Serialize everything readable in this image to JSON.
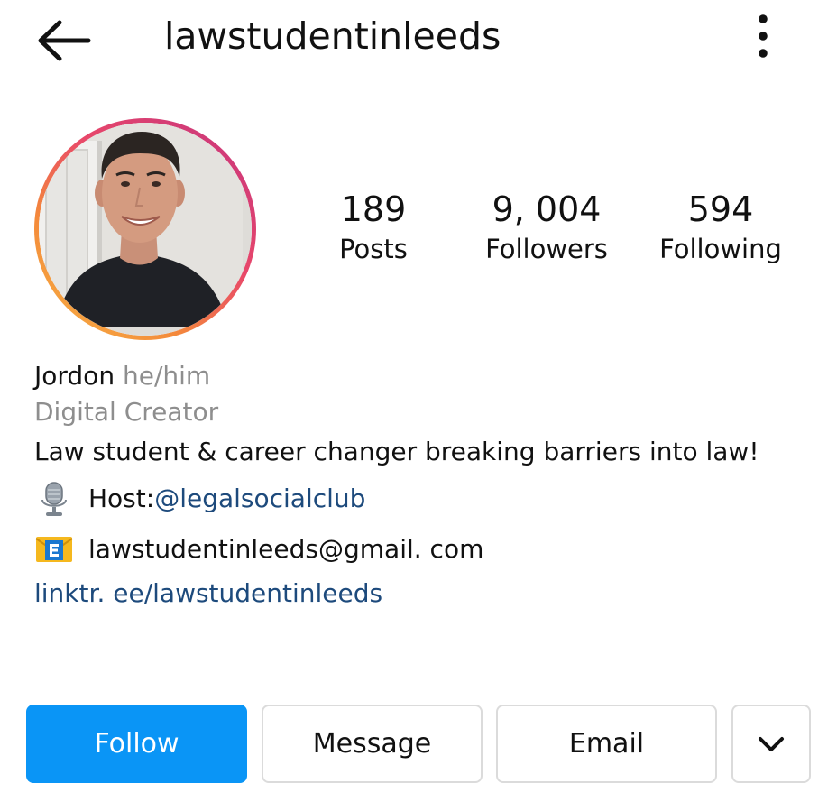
{
  "header": {
    "username": "lawstudentinleeds",
    "back_icon": "arrow-left-icon",
    "more_icon": "vertical-dots-icon"
  },
  "profile": {
    "avatar": "profile-photo",
    "ring_colors": [
      "#f6b545",
      "#f48a3a",
      "#e8476a",
      "#c4347f"
    ]
  },
  "stats": {
    "posts": {
      "value": "189",
      "label": "Posts"
    },
    "followers": {
      "value": "9, 004",
      "label": "Followers"
    },
    "following": {
      "value": "594",
      "label": "Following"
    }
  },
  "bio": {
    "name": "Jordon",
    "pronouns": "he/him",
    "category": "Digital Creator",
    "text": "Law student & career changer breaking barriers into law!",
    "host_prefix": "Host: ",
    "host_handle": "@legalsocialclub",
    "host_icon": "microphone-icon",
    "email": "lawstudentinleeds@gmail. com",
    "email_icon": "e-mail-icon",
    "link": "linktr. ee/lawstudentinleeds"
  },
  "actions": {
    "follow": "Follow",
    "message": "Message",
    "email": "Email",
    "more_icon": "chevron-down-icon",
    "accent": "#0a95f6"
  }
}
